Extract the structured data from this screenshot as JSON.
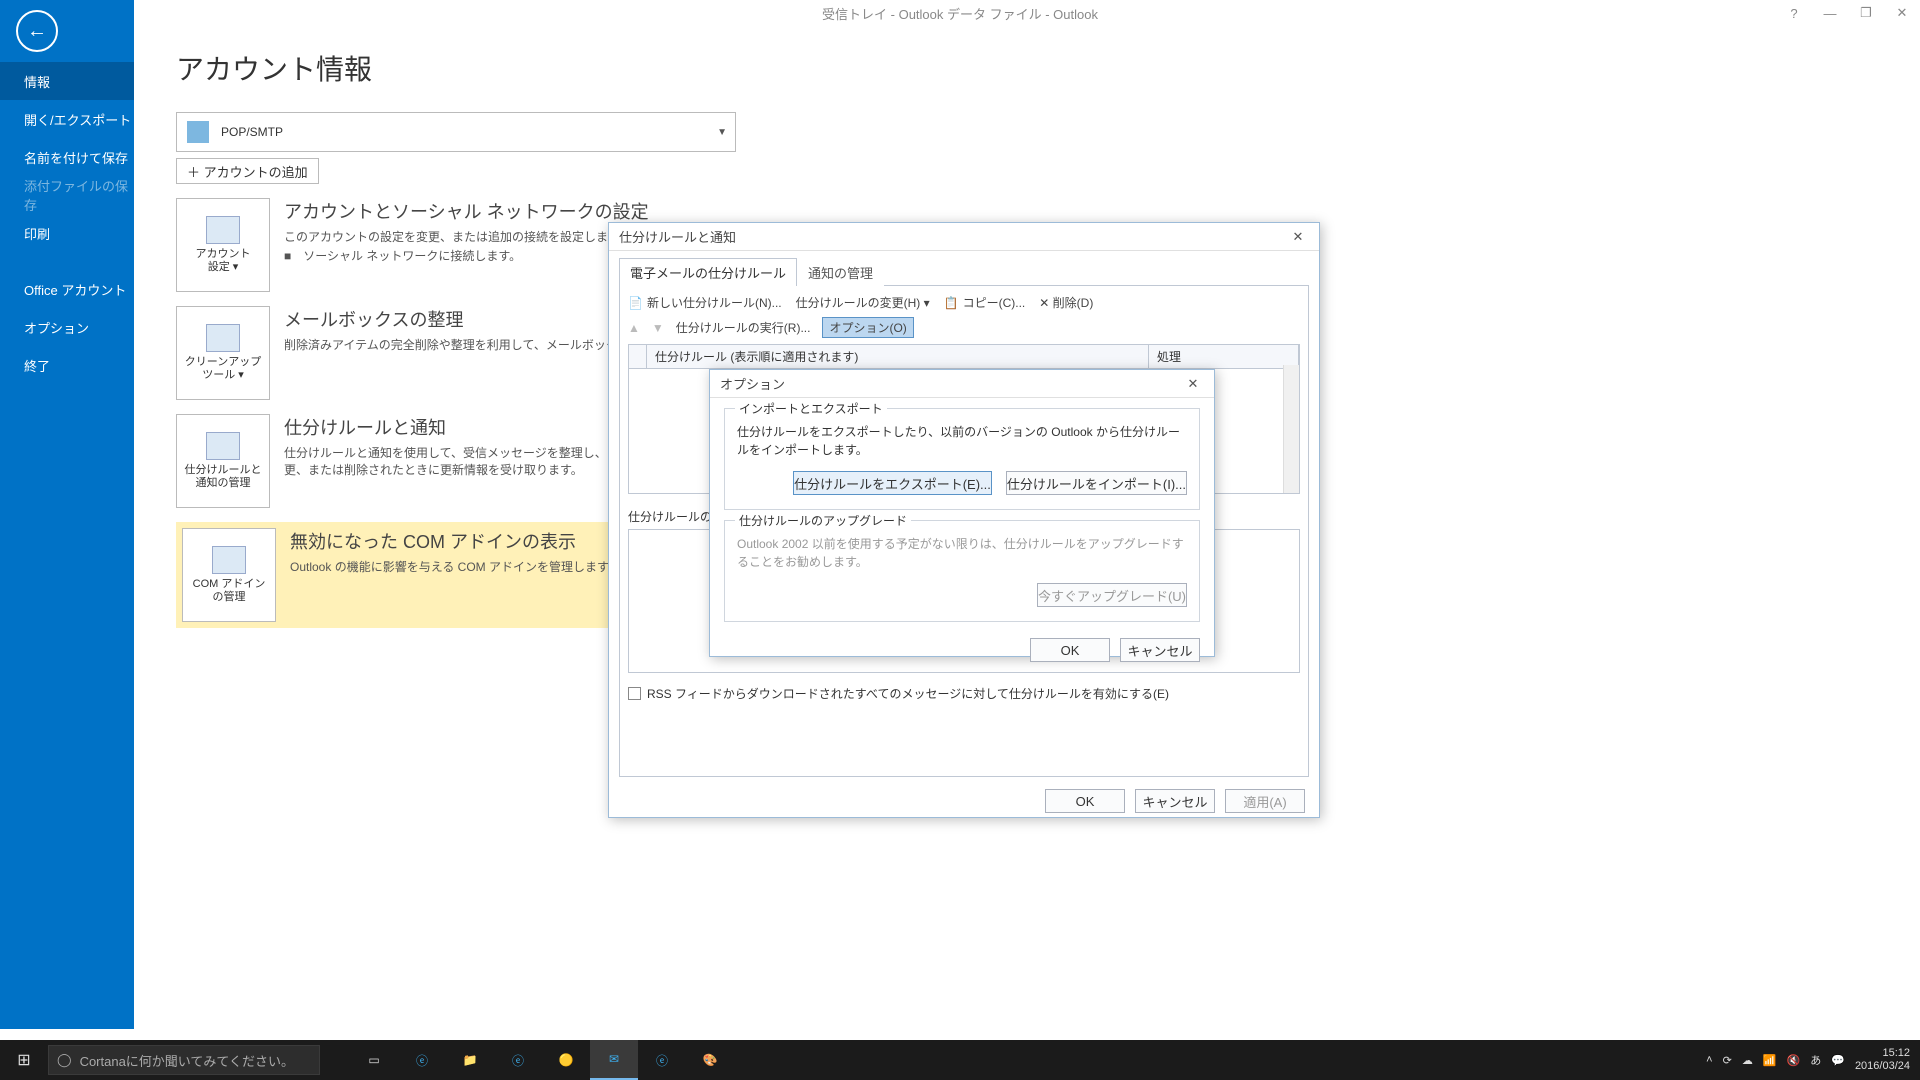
{
  "title": "受信トレイ - Outlook データ ファイル - Outlook",
  "win": {
    "help": "?",
    "min": "—",
    "max": "❐",
    "close": "✕"
  },
  "side": {
    "items": [
      {
        "label": "情報",
        "sel": true
      },
      {
        "label": "開く/エクスポート"
      },
      {
        "label": "名前を付けて保存"
      },
      {
        "label": "添付ファイルの保存",
        "dis": true
      },
      {
        "label": "印刷"
      }
    ],
    "items2": [
      {
        "label": "Office アカウント"
      },
      {
        "label": "オプション"
      },
      {
        "label": "終了"
      }
    ]
  },
  "page": {
    "h1": "アカウント情報",
    "account_type": "POP/SMTP",
    "add_account": "＋ アカウントの追加",
    "blocks": {
      "b1": {
        "btn": "アカウント\n設定 ▾",
        "title": "アカウントとソーシャル ネットワークの設定",
        "l1": "このアカウントの設定を変更、または追加の接続を設定します。",
        "l2": "■　ソーシャル ネットワークに接続します。"
      },
      "b2": {
        "btn": "クリーンアップ\nツール ▾",
        "title": "メールボックスの整理",
        "l1": "削除済みアイテムの完全削除や整理を利用して、メールボックスを整理します。"
      },
      "b3": {
        "btn": "仕分けルールと\n通知の管理",
        "title": "仕分けルールと通知",
        "l1": "仕分けルールと通知を使用して、受信メッセージを整理し、アイテムが追加、変更、または削除されたときに更新情報を受け取ります。"
      },
      "b4": {
        "btn": "COM アドイン\nの管理",
        "title": "無効になった COM アドインの表示",
        "l1": "Outlook の機能に影響を与える COM アドインを管理します。"
      }
    }
  },
  "dlg1": {
    "title": "仕分けルールと通知",
    "tab1": "電子メールの仕分けルール",
    "tab2": "通知の管理",
    "tool": {
      "new": "新しい仕分けルール(N)...",
      "change": "仕分けルールの変更(H) ▾",
      "copy": "コピー(C)...",
      "del": "✕ 削除(D)"
    },
    "sub": {
      "run": "仕分けルールの実行(R)...",
      "opt": "オプション(O)"
    },
    "col1": "仕分けルール (表示順に適用されます)",
    "col2": "処理",
    "desc": "仕分けルールの説明 (編集するには下線部をクリックしてください):",
    "rss": "RSS フィードからダウンロードされたすべてのメッセージに対して仕分けルールを有効にする(E)",
    "ok": "OK",
    "cancel": "キャンセル",
    "apply": "適用(A)"
  },
  "dlg2": {
    "title": "オプション",
    "g1": "インポートとエクスポート",
    "g1txt": "仕分けルールをエクスポートしたり、以前のバージョンの Outlook から仕分けルールをインポートします。",
    "exp": "仕分けルールをエクスポート(E)...",
    "imp": "仕分けルールをインポート(I)...",
    "g2": "仕分けルールのアップグレード",
    "g2txt": "Outlook 2002 以前を使用する予定がない限りは、仕分けルールをアップグレードすることをお勧めします。",
    "upg": "今すぐアップグレード(U)",
    "ok": "OK",
    "cancel": "キャンセル"
  },
  "taskbar": {
    "search": "Cortanaに何か聞いてみてください。",
    "time": "15:12",
    "date": "2016/03/24"
  }
}
